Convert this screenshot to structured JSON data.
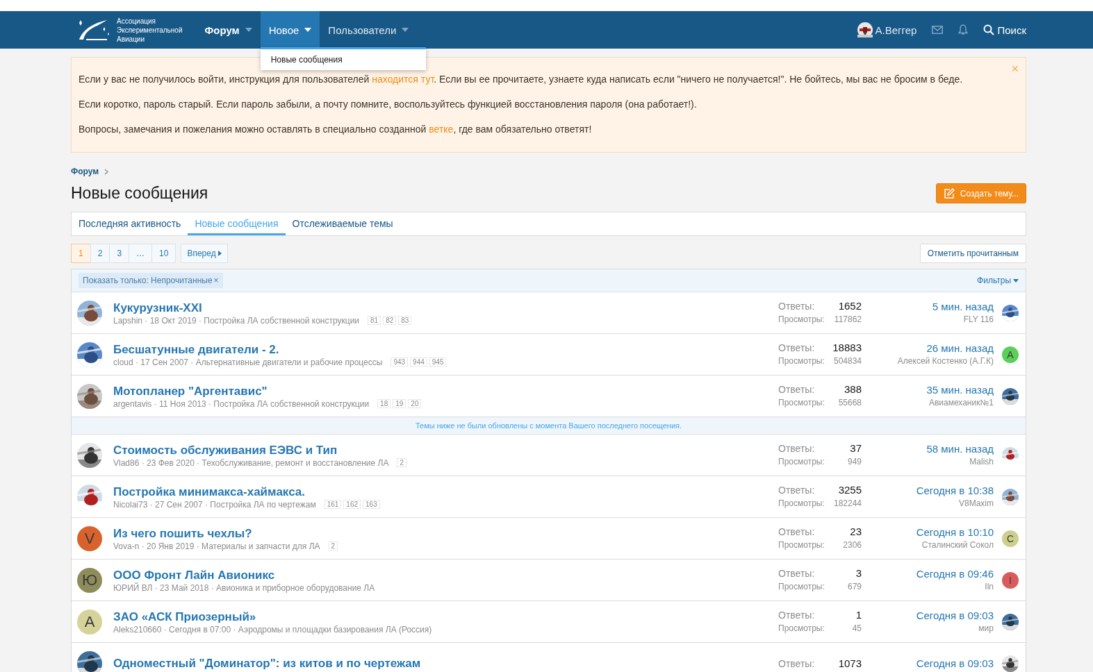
{
  "nav": {
    "logo_lines": [
      "Ассоциация",
      "Экспериментальной",
      "Авиации"
    ],
    "items": [
      {
        "label": "Форум",
        "selected": false
      },
      {
        "label": "Новое",
        "selected": true
      },
      {
        "label": "Пользователи",
        "selected": false
      }
    ],
    "dropdown": [
      "Новые сообщения"
    ],
    "user": "А.Веггер",
    "search": "Поиск"
  },
  "notice": {
    "paragraphs": [
      [
        {
          "kind": "text",
          "text": "Если у вас не получилось войти, инструкция для пользователей "
        },
        {
          "kind": "link",
          "text": "находится тут"
        },
        {
          "kind": "text",
          "text": ". Если вы ее прочитаете, узнаете куда написать если \"ничего не получается!\". Не бойтесь, мы вас не бросим в беде."
        }
      ],
      [
        {
          "kind": "text",
          "text": "Если коротко, пароль старый. Если пароль забыли, а почту помните, воспользуйтесь функцией восстановления пароля (она работает!)."
        }
      ],
      [
        {
          "kind": "text",
          "text": "Вопросы, замечания и пожелания можно оставлять в специально созданной "
        },
        {
          "kind": "link",
          "text": "ветке"
        },
        {
          "kind": "text",
          "text": ", где вам обязательно ответят!"
        }
      ]
    ],
    "close": "×"
  },
  "breadcrumb": "Форум",
  "title": "Новые сообщения",
  "create_button": "Создать тему...",
  "tabs": [
    {
      "label": "Последняя активность",
      "selected": false
    },
    {
      "label": "Новые сообщения",
      "selected": true
    },
    {
      "label": "Отслеживаемые темы",
      "selected": false
    }
  ],
  "pagination": {
    "pages": [
      {
        "label": "1",
        "selected": true
      },
      {
        "label": "2",
        "selected": false
      },
      {
        "label": "3",
        "selected": false
      },
      {
        "label": "…",
        "selected": false
      },
      {
        "label": "10",
        "selected": false
      }
    ],
    "next": "Вперед"
  },
  "mark_read": "Отметить прочитанным",
  "filter": {
    "chip": "Показать только: Непрочитанные",
    "chip_close": "×",
    "filters": "Фильтры"
  },
  "rows": [
    {
      "kind": "thread",
      "title": "Кукурузник-XXI",
      "meta": "Lapshin · 18 Окт 2019 · Постройка ЛА собственной конструкции",
      "pages": [
        "81",
        "82",
        "83"
      ],
      "replies_label": "Ответы:",
      "views_label": "Просмотры:",
      "replies": "1652",
      "views": "117862",
      "last_time": "5 мин. назад",
      "last_user": "FLY 116",
      "avatar": {
        "kind": "picture"
      },
      "last_avatar": {
        "kind": "picture"
      }
    },
    {
      "kind": "thread",
      "title": "Бесшатунные двигатели - 2.",
      "meta": "cloud · 17 Сен 2007 · Альтернативные двигатели и рабочие процессы",
      "pages": [
        "943",
        "944",
        "945"
      ],
      "replies_label": "Ответы:",
      "views_label": "Просмотры:",
      "replies": "18883",
      "views": "504834",
      "last_time": "26 мин. назад",
      "last_user": "Алексей Костенко (А.Г.К)",
      "avatar": {
        "kind": "picture"
      },
      "last_avatar": {
        "kind": "letter",
        "letter": "A",
        "color": "#5bcf58"
      }
    },
    {
      "kind": "thread",
      "title": "Мотопланер \"Аргентавис\"",
      "meta": "argentavis · 11 Ноя 2013 · Постройка ЛА собственной конструкции",
      "pages": [
        "18",
        "19",
        "20"
      ],
      "replies_label": "Ответы:",
      "views_label": "Просмотры:",
      "replies": "388",
      "views": "55668",
      "last_time": "35 мин. назад",
      "last_user": "Авиамеханик№1",
      "avatar": {
        "kind": "picture"
      },
      "last_avatar": {
        "kind": "picture"
      }
    },
    {
      "kind": "divider",
      "text": "Темы ниже не были обновлены с момента Вашего последнего посещения."
    },
    {
      "kind": "thread",
      "title": "Стоимость обслуживания ЕЭВС и Тип",
      "meta": "Vlad86 · 23 Фев 2020 · Техобслуживание, ремонт и восстановление ЛА",
      "pages": [
        "2"
      ],
      "replies_label": "Ответы:",
      "views_label": "Просмотры:",
      "replies": "37",
      "views": "949",
      "last_time": "58 мин. назад",
      "last_user": "Malish",
      "avatar": {
        "kind": "picture"
      },
      "last_avatar": {
        "kind": "picture"
      }
    },
    {
      "kind": "thread",
      "title": "Постройка минимакса-хаймакса.",
      "meta": "Nicolai73 · 27 Сен 2007 · Постройка ЛА по чертежам",
      "pages": [
        "161",
        "162",
        "163"
      ],
      "replies_label": "Ответы:",
      "views_label": "Просмотры:",
      "replies": "3255",
      "views": "182244",
      "last_time": "Сегодня в 10:38",
      "last_user": "V8Maxim",
      "avatar": {
        "kind": "picture"
      },
      "last_avatar": {
        "kind": "picture"
      }
    },
    {
      "kind": "thread",
      "title": "Из чего пошить чехлы?",
      "meta": "Vova-n · 20 Янв 2019 · Материалы и запчасти для ЛА",
      "pages": [
        "2"
      ],
      "replies_label": "Ответы:",
      "views_label": "Просмотры:",
      "replies": "23",
      "views": "2306",
      "last_time": "Сегодня в 10:10",
      "last_user": "Сталинский Сокол",
      "avatar": {
        "kind": "letter",
        "letter": "V",
        "color": "#d9622c"
      },
      "last_avatar": {
        "kind": "letter",
        "letter": "C",
        "color": "#ccd08c"
      }
    },
    {
      "kind": "thread",
      "title": "ООО Фронт Лайн Авионикс",
      "meta": "ЮРИЙ ВЛ · 23 Май 2018 · Авионика и приборное оборудование ЛА",
      "replies_label": "Ответы:",
      "views_label": "Просмотры:",
      "replies": "3",
      "views": "679",
      "last_time": "Сегодня в 09:46",
      "last_user": "Iln",
      "avatar": {
        "kind": "letter",
        "letter": "Ю",
        "color": "#8e8c5a"
      },
      "last_avatar": {
        "kind": "letter",
        "letter": "I",
        "color": "#d95c5c"
      }
    },
    {
      "kind": "thread",
      "title": "ЗАО «АСК Приозерный»",
      "meta": "Aleks210660 · Сегодня в 07:00 · Аэродромы и площадки базирования ЛА (Россия)",
      "replies_label": "Ответы:",
      "views_label": "Просмотры:",
      "replies": "1",
      "views": "45",
      "last_time": "Сегодня в 09:03",
      "last_user": "мир",
      "avatar": {
        "kind": "letter",
        "letter": "A",
        "color": "#d6d39a"
      },
      "last_avatar": {
        "kind": "picture"
      }
    },
    {
      "kind": "thread",
      "title": "Одноместный \"Доминатор\": из китов и по чертежам",
      "replies_label": "Ответы:",
      "replies": "1073",
      "last_time": "Сегодня в 09:03",
      "avatar": {
        "kind": "picture"
      },
      "last_avatar": {
        "kind": "picture"
      }
    }
  ]
}
